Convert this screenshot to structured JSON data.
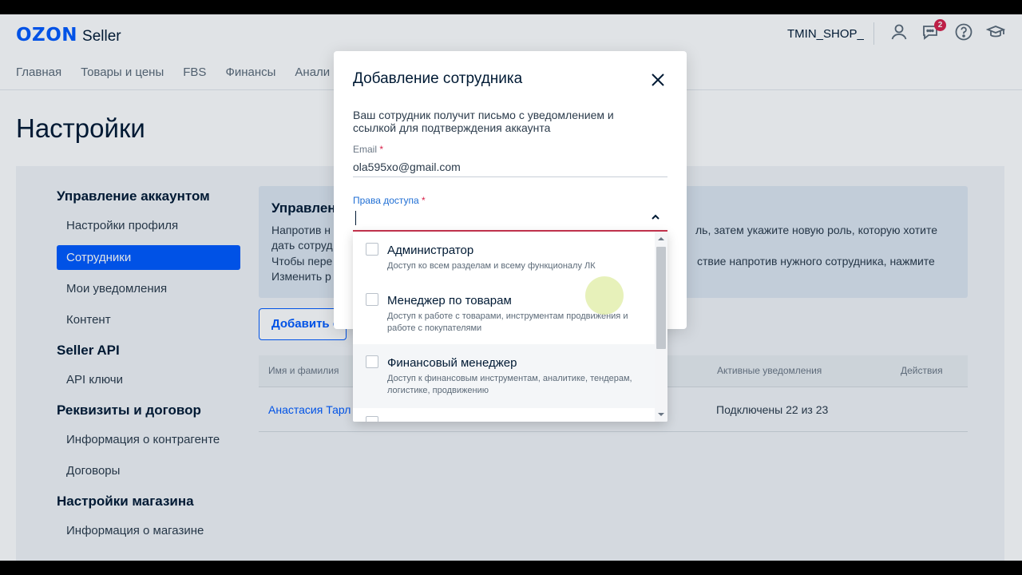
{
  "header": {
    "logo_brand": "OZON",
    "logo_product": "Seller",
    "shop_name": "TMIN_SHOP_",
    "notifications_count": "2"
  },
  "nav": {
    "items": [
      "Главная",
      "Товары и цены",
      "FBS",
      "Финансы",
      "Анали"
    ]
  },
  "page": {
    "title": "Настройки"
  },
  "sidebar": {
    "sections": [
      {
        "label": "Управление аккаунтом",
        "items": [
          "Настройки профиля",
          "Сотрудники",
          "Мои уведомления",
          "Контент"
        ]
      },
      {
        "label": "Seller API",
        "items": [
          "API ключи"
        ]
      },
      {
        "label": "Реквизиты и договор",
        "items": [
          "Информация о контрагенте",
          "Договоры"
        ]
      },
      {
        "label": "Настройки магазина",
        "items": [
          "Информация о магазине"
        ]
      }
    ],
    "active_item": "Сотрудники"
  },
  "info": {
    "title": "Управлен",
    "line1_left": "Напротив н",
    "line1_right": "ль, затем укажите новую роль, которую хотите",
    "line2_left": "дать сотруд",
    "line3_left": "Чтобы пере",
    "line3_right": "ствие напротив нужного сотрудника, нажмите",
    "line4_left": "Изменить р"
  },
  "add_button": {
    "label": "Добавить с"
  },
  "table": {
    "headers": {
      "name": "Имя и фамилия",
      "notifications": "Активные уведомления",
      "actions": "Действия"
    },
    "rows": [
      {
        "name": "Анастасия Тарл",
        "notifications": "Подключены 22 из 23"
      }
    ]
  },
  "modal": {
    "title": "Добавление сотрудника",
    "description": "Ваш сотрудник получит письмо с уведомлением и ссылкой для подтверждения аккаунта",
    "email_label": "Email",
    "email_value": "ola595xo@gmail.com",
    "access_label": "Права доступа",
    "required_mark": "*",
    "options": [
      {
        "title": "Администратор",
        "desc": "Доступ ко всем разделам и всему функционалу ЛК"
      },
      {
        "title": "Менеджер по товарам",
        "desc": "Доступ к работе с товарами, инструментам продвижения и работе с покупателями"
      },
      {
        "title": "Финансовый менеджер",
        "desc": "Доступ к финансовым инструментам, аналитике, тендерам, логистике, продвижению"
      }
    ]
  },
  "colors": {
    "brand": "#005bff",
    "error_underline": "#c8344f",
    "badge": "#d8224a"
  }
}
